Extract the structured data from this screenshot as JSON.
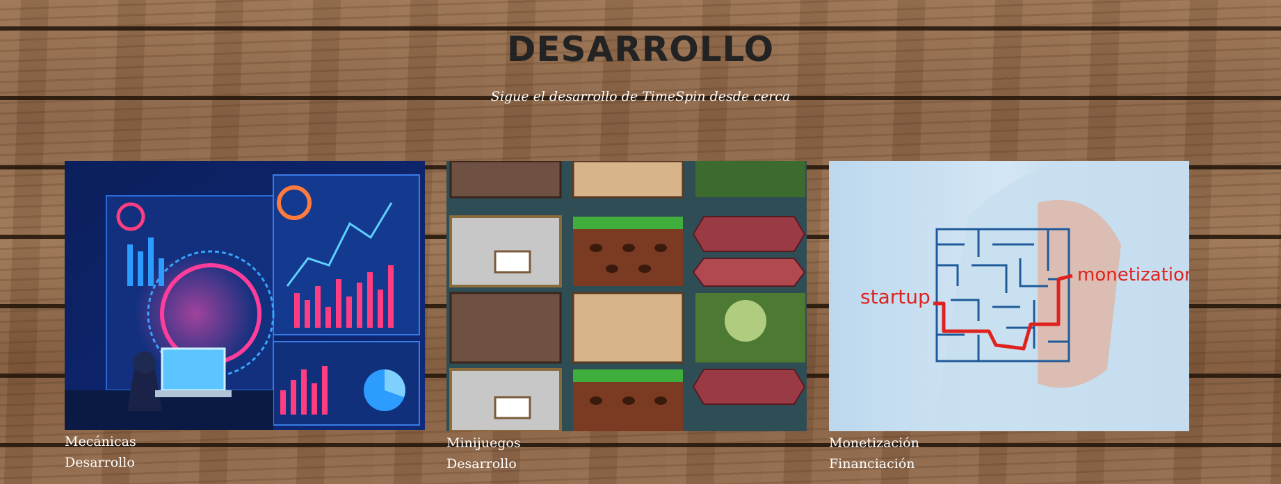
{
  "header": {
    "title": "DESARROLLO",
    "subtitle": "Sigue el desarrollo de TimeSpin desde cerca"
  },
  "cards": [
    {
      "title": "Mecánicas",
      "category": "Desarrollo",
      "image_text": []
    },
    {
      "title": "Minijuegos",
      "category": "Desarrollo",
      "image_text": []
    },
    {
      "title": "Monetización",
      "category": "Financiación",
      "image_text": [
        "startup",
        "monetization"
      ]
    }
  ],
  "colors": {
    "title": "#232323",
    "text": "#ffffff",
    "wood_light": "#9a7353",
    "wood_dark": "#2a1a0c"
  }
}
